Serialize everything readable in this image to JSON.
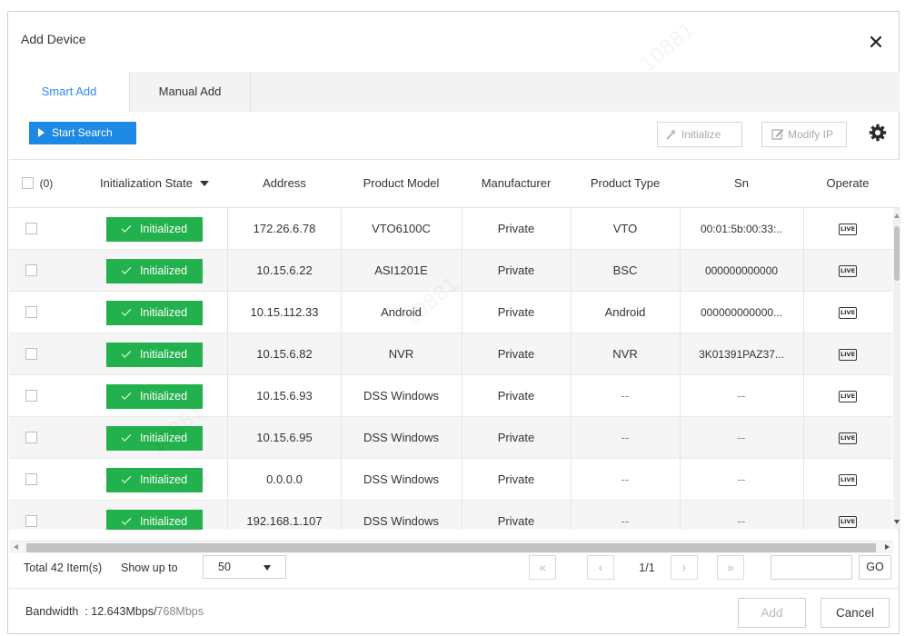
{
  "dialog": {
    "title": "Add Device"
  },
  "tabs": [
    {
      "label": "Smart Add",
      "active": true
    },
    {
      "label": "Manual Add",
      "active": false
    }
  ],
  "toolbar": {
    "start_search": "Start Search",
    "initialize": "Initialize",
    "modify_ip": "Modify IP"
  },
  "table": {
    "select_count": "(0)",
    "columns": [
      "Initialization State",
      "Address",
      "Product Model",
      "Manufacturer",
      "Product Type",
      "Sn",
      "Operate"
    ],
    "rows": [
      {
        "state": "Initialized",
        "address": "172.26.6.78",
        "model": "VTO6100C",
        "manufacturer": "Private",
        "type": "VTO",
        "sn": "00:01:5b:00:33:..",
        "operate": "LIVE"
      },
      {
        "state": "Initialized",
        "address": "10.15.6.22",
        "model": "ASI1201E",
        "manufacturer": "Private",
        "type": "BSC",
        "sn": "000000000000",
        "operate": "LIVE"
      },
      {
        "state": "Initialized",
        "address": "10.15.112.33",
        "model": "Android",
        "manufacturer": "Private",
        "type": "Android",
        "sn": "000000000000...",
        "operate": "LIVE"
      },
      {
        "state": "Initialized",
        "address": "10.15.6.82",
        "model": "NVR",
        "manufacturer": "Private",
        "type": "NVR",
        "sn": "3K01391PAZ37...",
        "operate": "LIVE"
      },
      {
        "state": "Initialized",
        "address": "10.15.6.93",
        "model": "DSS Windows",
        "manufacturer": "Private",
        "type": "--",
        "sn": "--",
        "operate": "LIVE"
      },
      {
        "state": "Initialized",
        "address": "10.15.6.95",
        "model": "DSS Windows",
        "manufacturer": "Private",
        "type": "--",
        "sn": "--",
        "operate": "LIVE"
      },
      {
        "state": "Initialized",
        "address": "0.0.0.0",
        "model": "DSS Windows",
        "manufacturer": "Private",
        "type": "--",
        "sn": "--",
        "operate": "LIVE"
      },
      {
        "state": "Initialized",
        "address": "192.168.1.107",
        "model": "DSS Windows",
        "manufacturer": "Private",
        "type": "--",
        "sn": "--",
        "operate": "LIVE"
      }
    ]
  },
  "pager": {
    "total": "Total 42 Item(s)",
    "show_up_to": "Show up to",
    "page_size": "50",
    "first": "«",
    "prev": "‹",
    "page": "1/1",
    "next": "›",
    "last": "»",
    "go": "GO"
  },
  "footer": {
    "bandwidth_label": "Bandwidth  : 12.643Mbps/",
    "bandwidth_max": "768Mbps",
    "add": "Add",
    "cancel": "Cancel"
  },
  "colors": {
    "accent": "#1e88e5",
    "tab_active": "#2d8cf0",
    "initialized": "#22b14c"
  },
  "icons": [
    "close-icon",
    "play-icon",
    "initialize-icon",
    "edit-icon",
    "gear-icon",
    "live-icon",
    "sort-down-icon"
  ]
}
